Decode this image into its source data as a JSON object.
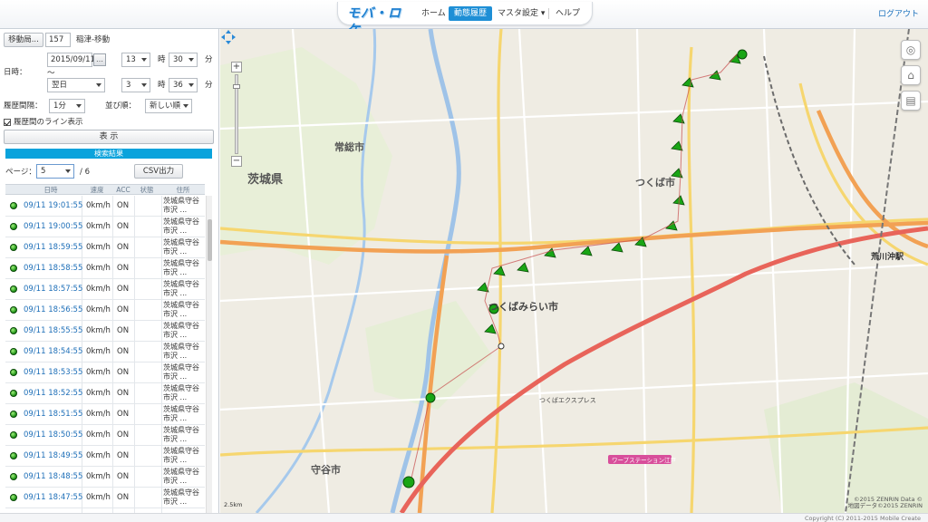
{
  "header": {
    "logo": "モバ・ロケ",
    "nav": [
      {
        "label": "ホーム"
      },
      {
        "label": "動態履歴"
      },
      {
        "label": "マスタ設定 ▾"
      },
      {
        "label": "ヘルプ"
      }
    ],
    "logout": "ログアウト"
  },
  "sidebar": {
    "vehicle_button": "移動局...",
    "vehicle_id": "157",
    "vehicle_name": "稲津-移動",
    "datetime_label": "日時：",
    "start_date": "2015/09/11",
    "start_hour": "13",
    "start_min": "30",
    "hour_unit": "時",
    "min_unit": "分",
    "tilde": "～",
    "end_day": "翌日",
    "end_hour": "3",
    "end_min": "36",
    "interval_label": "履歴間隔：",
    "interval_value": "1分",
    "order_label": "並び順：",
    "order_value": "新しい順",
    "line_label": "履歴間のライン表示",
    "show_button": "表 示",
    "result_label": "検索結果",
    "page_label": "ページ：",
    "page_value": "5",
    "page_total": "/ 6",
    "csv_button": "CSV出力",
    "table": {
      "headers": [
        "日時",
        "速度",
        "ACC",
        "状態",
        "住所"
      ],
      "rows": [
        {
          "time": "09/11 19:01:55",
          "speed": "0km/h",
          "acc": "ON",
          "addr": "茨城県守谷市沢 ..."
        },
        {
          "time": "09/11 19:00:55",
          "speed": "0km/h",
          "acc": "ON",
          "addr": "茨城県守谷市沢 ..."
        },
        {
          "time": "09/11 18:59:55",
          "speed": "0km/h",
          "acc": "ON",
          "addr": "茨城県守谷市沢 ..."
        },
        {
          "time": "09/11 18:58:55",
          "speed": "0km/h",
          "acc": "ON",
          "addr": "茨城県守谷市沢 ..."
        },
        {
          "time": "09/11 18:57:55",
          "speed": "0km/h",
          "acc": "ON",
          "addr": "茨城県守谷市沢 ..."
        },
        {
          "time": "09/11 18:56:55",
          "speed": "0km/h",
          "acc": "ON",
          "addr": "茨城県守谷市沢 ..."
        },
        {
          "time": "09/11 18:55:55",
          "speed": "0km/h",
          "acc": "ON",
          "addr": "茨城県守谷市沢 ..."
        },
        {
          "time": "09/11 18:54:55",
          "speed": "0km/h",
          "acc": "ON",
          "addr": "茨城県守谷市沢 ..."
        },
        {
          "time": "09/11 18:53:55",
          "speed": "0km/h",
          "acc": "ON",
          "addr": "茨城県守谷市沢 ..."
        },
        {
          "time": "09/11 18:52:55",
          "speed": "0km/h",
          "acc": "ON",
          "addr": "茨城県守谷市沢 ..."
        },
        {
          "time": "09/11 18:51:55",
          "speed": "0km/h",
          "acc": "ON",
          "addr": "茨城県守谷市沢 ..."
        },
        {
          "time": "09/11 18:50:55",
          "speed": "0km/h",
          "acc": "ON",
          "addr": "茨城県守谷市沢 ..."
        },
        {
          "time": "09/11 18:49:55",
          "speed": "0km/h",
          "acc": "ON",
          "addr": "茨城県守谷市沢 ..."
        },
        {
          "time": "09/11 18:48:55",
          "speed": "0km/h",
          "acc": "ON",
          "addr": "茨城県守谷市沢 ..."
        },
        {
          "time": "09/11 18:47:55",
          "speed": "0km/h",
          "acc": "ON",
          "addr": "茨城県守谷市沢 ..."
        }
      ]
    }
  },
  "map": {
    "labels": {
      "ibaraki": "茨城県",
      "joso": "常総市",
      "tsukuba": "つくば市",
      "tsukubamirai": "つくばみらい市",
      "moriya": "守谷市",
      "arakawaoki": "荒川沖駅",
      "station_tx": "つくばエクスプレス",
      "ws_edo": "ワープステーション江戸"
    },
    "attribution": [
      "©2015 ZENRIN Data ©",
      "地図データ©2015 ZENRIN"
    ],
    "scale": "2.5km"
  },
  "footer": {
    "copyright": "Copyright (C) 2011-2015 Mobile Create"
  }
}
